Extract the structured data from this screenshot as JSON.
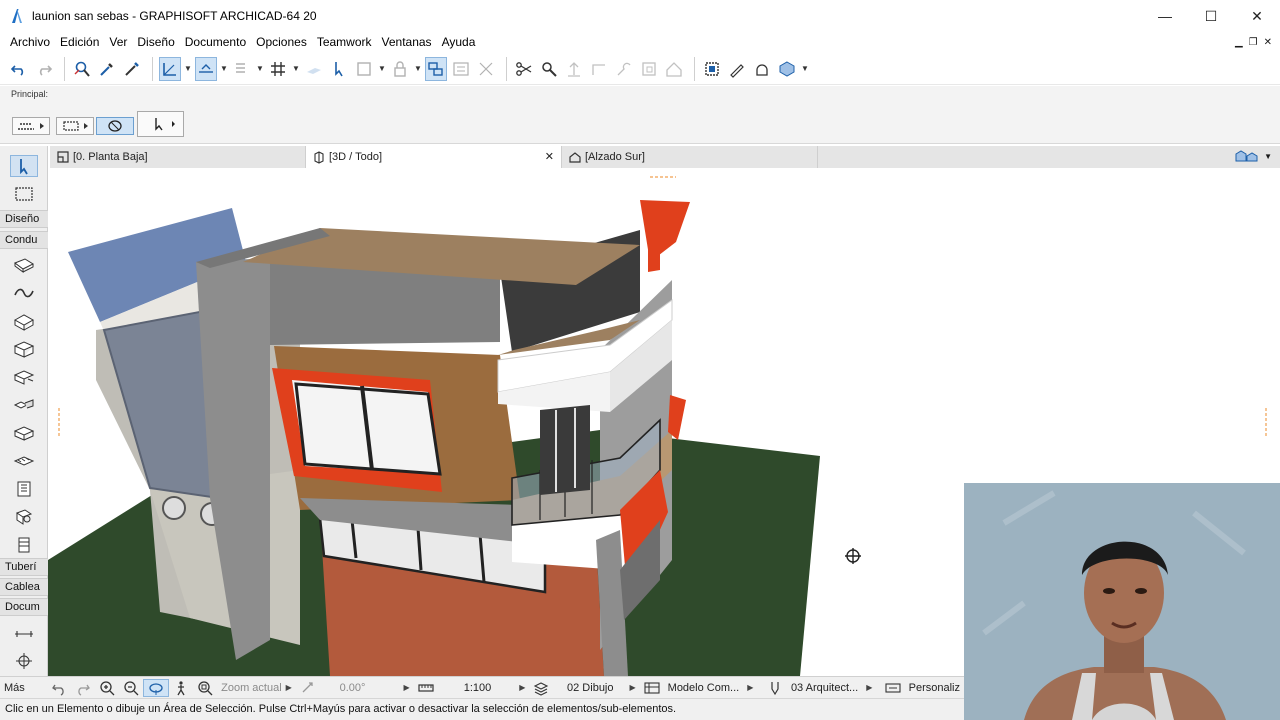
{
  "window": {
    "title": "launion san sebas - GRAPHISOFT ARCHICAD-64 20",
    "minimize": "—",
    "maximize": "☐",
    "close": "✕"
  },
  "menu": {
    "items": [
      "Archivo",
      "Edición",
      "Ver",
      "Diseño",
      "Documento",
      "Opciones",
      "Teamwork",
      "Ventanas",
      "Ayuda"
    ]
  },
  "infobox": {
    "label": "Principal:"
  },
  "tabs": [
    {
      "label": "[0. Planta Baja]",
      "icon": "floor-plan-icon"
    },
    {
      "label": "[3D / Todo]",
      "icon": "3d-window-icon",
      "close": "✕"
    },
    {
      "label": "[Alzado Sur]",
      "icon": "elevation-icon"
    }
  ],
  "toolbox": {
    "categories": [
      "Diseño",
      "Condu",
      "Tuberí",
      "Cablea",
      "Docum"
    ],
    "more": "Más"
  },
  "navbar": {
    "zoom_label": "Zoom actual",
    "angle": "0.00°",
    "scale": "1:100",
    "layer_combo": "02 Dibujo",
    "model_view": "Modelo Com...",
    "pen_set": "03 Arquitect...",
    "custom": "Personaliz"
  },
  "statusbar": {
    "text": "Clic en un Elemento o dibuje un Área de Selección. Pulse Ctrl+Mayús para activar o desactivar la selección de elementos/sub-elementos."
  },
  "colors": {
    "accent_red": "#e0401c",
    "grass": "#2f4a2b",
    "brick": "#b35a3c",
    "wood": "#9b6c3e",
    "glass_blue": "#6d86b4",
    "ui_selection": "#cfe3f6"
  }
}
